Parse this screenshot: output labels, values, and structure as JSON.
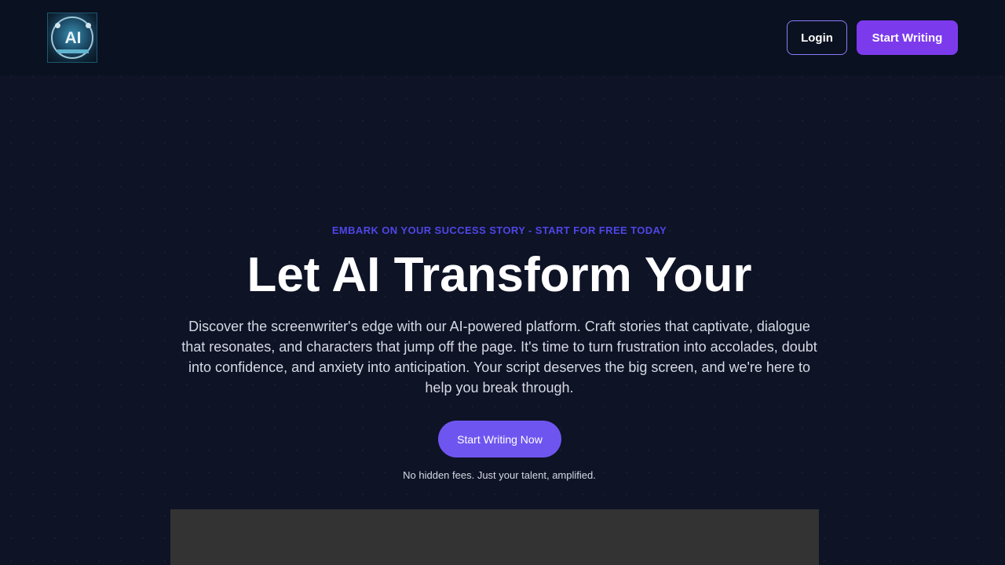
{
  "navbar": {
    "logo_icon": "ai-logo-icon",
    "login_label": "Login",
    "start_label": "Start Writing",
    "accent": "#7c3aed",
    "login_border": "#8b7cf6",
    "background": "#0a1120"
  },
  "hero": {
    "eyebrow": "EMBARK ON YOUR SUCCESS STORY - START FOR FREE TODAY",
    "headline": "Let AI Transform Your",
    "subtext": "Discover the screenwriter's edge with our AI-powered platform. Craft stories that captivate, dialogue that resonates, and characters that jump off the page. It's time to turn frustration into accolades, doubt into confidence, and anxiety into anticipation. Your script deserves the big screen, and we're here to help you break through.",
    "cta_label": "Start Writing Now",
    "note": "No hidden fees. Just your talent, amplified.",
    "eyebrow_color": "#4f46e5",
    "cta_color": "#6f55f0",
    "background": "#0e1326"
  },
  "media": {
    "background": "#333333"
  }
}
